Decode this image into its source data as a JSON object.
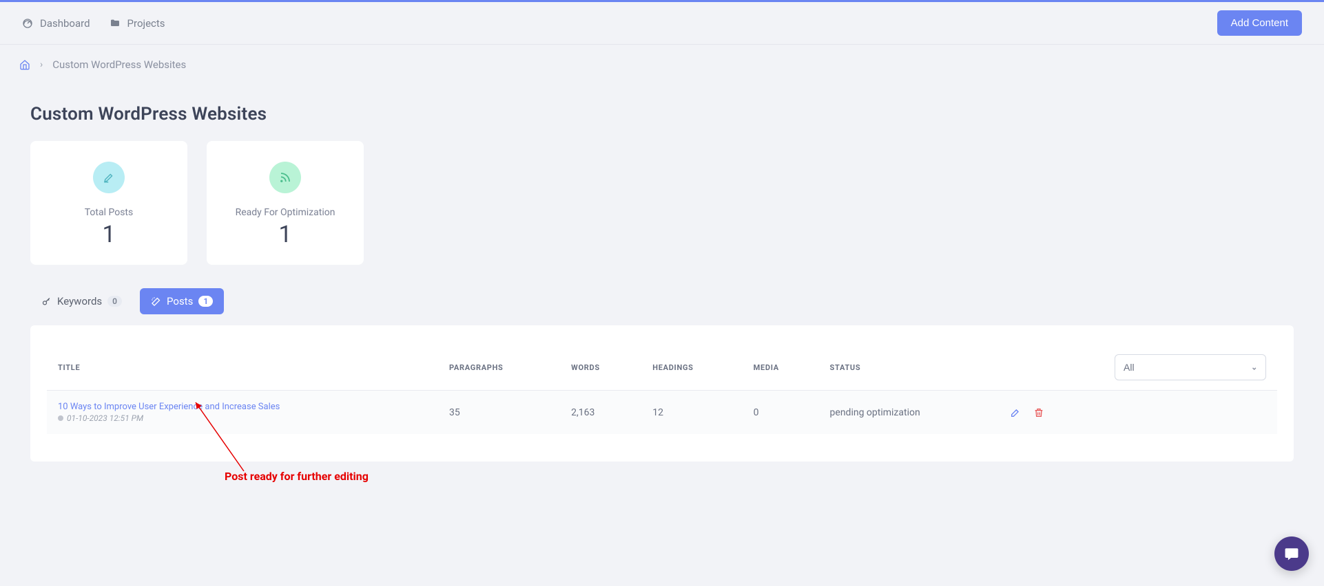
{
  "nav": {
    "dashboard": "Dashboard",
    "projects": "Projects",
    "add_content": "Add Content"
  },
  "breadcrumb": {
    "current": "Custom WordPress Websites"
  },
  "page_title": "Custom WordPress Websites",
  "stats": {
    "total_posts": {
      "label": "Total Posts",
      "value": "1"
    },
    "ready": {
      "label": "Ready For Optimization",
      "value": "1"
    }
  },
  "tabs": {
    "keywords": {
      "label": "Keywords",
      "count": "0"
    },
    "posts": {
      "label": "Posts",
      "count": "1"
    }
  },
  "table": {
    "headers": {
      "title": "TITLE",
      "paragraphs": "PARAGRAPHS",
      "words": "WORDS",
      "headings": "HEADINGS",
      "media": "MEDIA",
      "status": "STATUS"
    },
    "filter": {
      "selected": "All"
    },
    "rows": [
      {
        "title": "10 Ways to Improve User Experience and Increase Sales",
        "timestamp": "01-10-2023 12:51 PM",
        "paragraphs": "35",
        "words": "2,163",
        "headings": "12",
        "media": "0",
        "status": "pending optimization"
      }
    ]
  },
  "annotation": "Post ready for further editing"
}
